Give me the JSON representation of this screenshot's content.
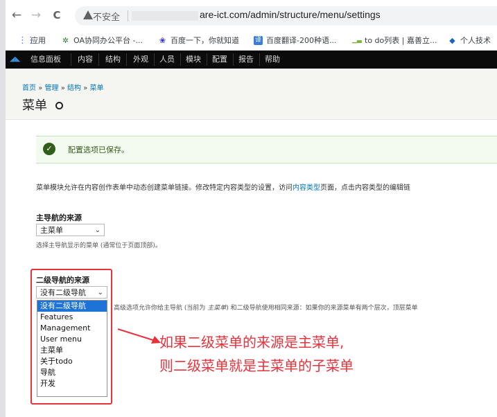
{
  "browser": {
    "back": "←",
    "forward": "→",
    "reload": "C",
    "security_label": "不安全",
    "url": "are-ict.com/admin/structure/menu/settings"
  },
  "bookmarks": [
    {
      "icon": "apps-grid-icon",
      "label": "应用",
      "color": "#4285f4"
    },
    {
      "icon": "oa-gear-icon",
      "label": "OA协同办公平台 -...",
      "color": "#2e7d32"
    },
    {
      "icon": "baidu-paw-icon",
      "label": "百度一下，你就知道",
      "color": "#2932e1"
    },
    {
      "icon": "translate-icon",
      "label": "百度翻译-200种语...",
      "color": "#3a7bd5"
    },
    {
      "icon": "todo-icon",
      "label": "to do列表 | 嘉善立...",
      "color": "#7cb342"
    },
    {
      "icon": "diamond-icon",
      "label": "个人技术",
      "color": "#1565c0"
    }
  ],
  "toolbar": {
    "items": [
      "信息面板",
      "内容",
      "结构",
      "外观",
      "人员",
      "模块",
      "配置",
      "报告",
      "帮助"
    ]
  },
  "header": {
    "breadcrumb": [
      "首页",
      "管理",
      "结构",
      "菜单"
    ],
    "breadcrumb_sep": "»",
    "title": "菜单"
  },
  "status": {
    "check": "✓",
    "message": "配置选项已保存。"
  },
  "description": {
    "before": "菜单模块允许在内容创作表单中动态创建菜单链接。修改特定内容类型的设置，访问",
    "link": "内容类型",
    "after": "页面，点击内容类型的编辑链"
  },
  "main_nav": {
    "label": "主导航的来源",
    "value": "主菜单",
    "help": "选择主导航显示的菜单 (通常位于页面顶部)。"
  },
  "secondary_nav": {
    "label": "二级导航的来源",
    "value": "没有二级导航",
    "help_prefix": "高级选项允许你给主导航 (当前为 ",
    "help_em": "主菜单",
    "help_suffix": ") 和二级导航使用相同来源：如果你的来源菜单有两个层次，顶层菜单",
    "options": [
      "没有二级导航",
      "Features",
      "Management",
      "User menu",
      "主菜单",
      "关于todo",
      "导航",
      "开发"
    ],
    "selected_index": 0
  },
  "annotation": {
    "line1": "如果二级菜单的来源是主菜单,",
    "line2": "则二级菜单就是主菜单的子菜单",
    "color": "#e8323b"
  }
}
